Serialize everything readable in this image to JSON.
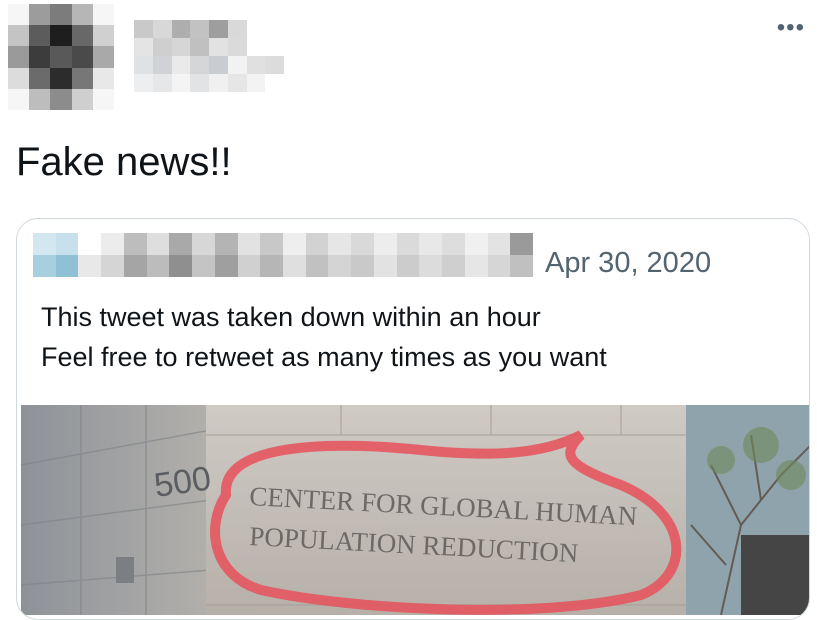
{
  "tweet": {
    "text": "Fake news!!",
    "more_icon": "more-horizontal-icon"
  },
  "quote": {
    "date": "Apr 30, 2020",
    "lines": [
      "This tweet was taken down within an hour",
      "Feel free to retweet as many times as you want"
    ],
    "image": {
      "building_number": "500",
      "sign_line1": "CENTER FOR GLOBAL HUMAN",
      "sign_line2": "POPULATION REDUCTION"
    }
  }
}
